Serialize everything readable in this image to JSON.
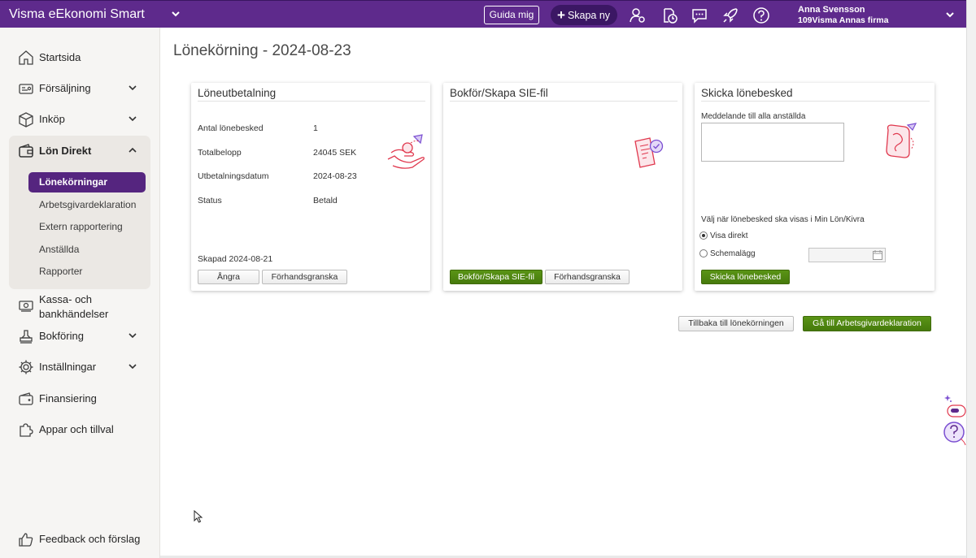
{
  "app": {
    "title": "Visma eEkonomi Smart"
  },
  "topbar": {
    "guide_label": "Guida mig",
    "create_label": "Skapa ny",
    "icons": [
      "user-settings-icon",
      "clock-document-icon",
      "chat-icon",
      "rocket-icon",
      "help-icon"
    ],
    "user_name": "Anna Svensson",
    "user_company": "109Visma Annas firma",
    "brand_color": "#5e2a8c"
  },
  "sidebar": {
    "items": [
      {
        "label": "Startsida",
        "icon": "home-icon"
      },
      {
        "label": "Försäljning",
        "icon": "sales-icon"
      },
      {
        "label": "Inköp",
        "icon": "box-icon"
      },
      {
        "label": "Lön Direkt",
        "icon": "wallet-icon"
      },
      {
        "label": "Kassa- och",
        "label2": "bankhändelser",
        "icon": "cash-icon"
      },
      {
        "label": "Bokföring",
        "icon": "stamp-icon"
      },
      {
        "label": "Inställningar",
        "icon": "gear-icon"
      },
      {
        "label": "Finansiering",
        "icon": "finance-icon"
      },
      {
        "label": "Appar och tillval",
        "icon": "puzzle-icon"
      }
    ],
    "sub_items": [
      {
        "label": "Lönekörningar",
        "active": true
      },
      {
        "label": "Arbetsgivardeklaration"
      },
      {
        "label": "Extern rapportering"
      },
      {
        "label": "Anställda"
      },
      {
        "label": "Rapporter"
      }
    ],
    "feedback_label": "Feedback och förslag",
    "active_color": "#55257f"
  },
  "main": {
    "page_title": "Lönekörning - 2024-08-23",
    "card_payment": {
      "title": "Löneutbetalning",
      "rows": [
        {
          "label": "Antal lönebesked",
          "value": "1"
        },
        {
          "label": "Totalbelopp",
          "value": "24045 SEK"
        },
        {
          "label": "Utbetalningsdatum",
          "value": "2024-08-23"
        },
        {
          "label": "Status",
          "value": "Betald"
        }
      ],
      "created": "Skapad 2024-08-21",
      "undo_label": "Ångra",
      "preview_label": "Förhandsgranska"
    },
    "card_sie": {
      "title": "Bokför/Skapa SIE-fil",
      "book_label": "Bokför/Skapa SIE-fil",
      "preview_label": "Förhandsgranska"
    },
    "card_send": {
      "title": "Skicka lönebesked",
      "message_label": "Meddelande till alla anställda",
      "message_value": "",
      "choose_label": "Välj när lönebesked ska visas i Min Lön/Kivra",
      "option_direct": "Visa direkt",
      "option_schedule": "Schemalägg",
      "selected_option": "Visa direkt",
      "send_label": "Skicka lönebesked"
    },
    "back_label": "Tillbaka till lönekörningen",
    "next_label": "Gå till Arbetsgivardeklaration",
    "accent_green": "#4f860f"
  }
}
